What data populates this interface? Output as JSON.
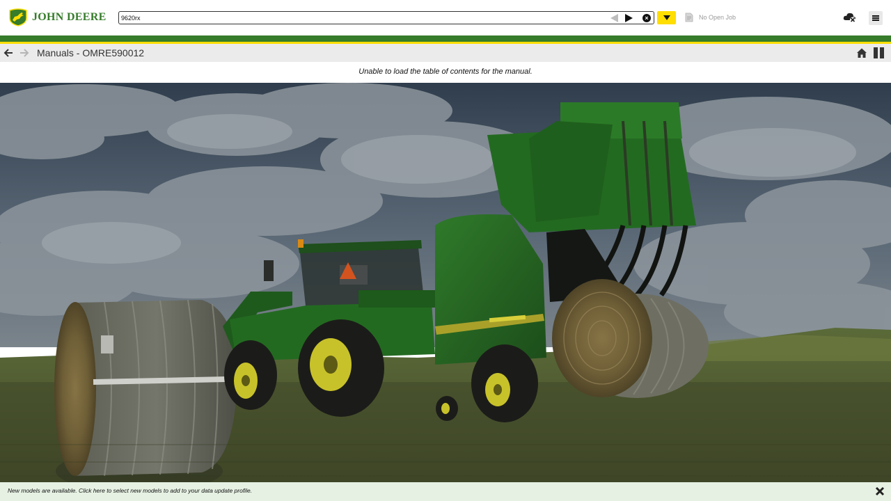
{
  "header": {
    "brand_name": "JOHN DEERE",
    "search_value": "9620rx",
    "job_label": "No Open Job"
  },
  "titlebar": {
    "title": "Manuals - OMRE590012"
  },
  "message": {
    "text": "Unable to load the table of contents for the manual."
  },
  "notification": {
    "text": "New models are available. Click here to select new models to add to your data update profile."
  },
  "colors": {
    "brand_green": "#367c2b",
    "brand_yellow": "#ffde00",
    "notification_bg": "#e6f1e3",
    "titlebar_bg": "#ebebeb"
  },
  "icons": {
    "logo": "leaping-deer-logo",
    "search_prev": "triangle-left-icon",
    "search_next": "triangle-right-icon",
    "search_clear": "clear-circle-icon",
    "dropdown": "caret-down-icon",
    "job": "document-icon",
    "cloud": "cloud-sync-icon",
    "menu": "hamburger-menu-icon",
    "back": "arrow-left-icon",
    "forward": "arrow-right-icon",
    "home": "home-icon",
    "split_view": "split-view-icon",
    "close": "close-icon"
  }
}
